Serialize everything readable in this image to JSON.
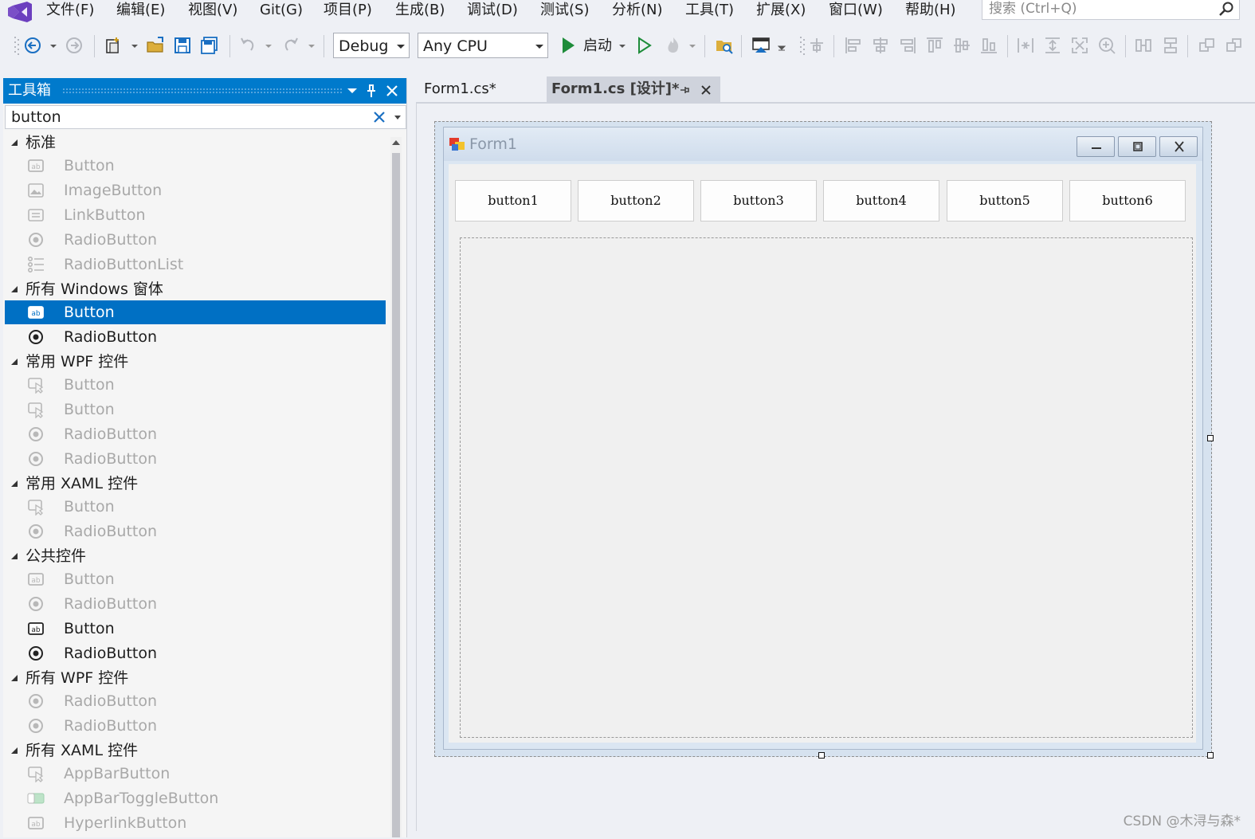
{
  "menu": {
    "items": [
      "文件(F)",
      "编辑(E)",
      "视图(V)",
      "Git(G)",
      "项目(P)",
      "生成(B)",
      "调试(D)",
      "测试(S)",
      "分析(N)",
      "工具(T)",
      "扩展(X)",
      "窗口(W)",
      "帮助(H)"
    ],
    "search_placeholder": "搜索 (Ctrl+Q)"
  },
  "toolbar": {
    "configuration": "Debug",
    "platform": "Any CPU",
    "start_label": "启动",
    "accent_color": "#1e8c3a"
  },
  "toolbox": {
    "title": "工具箱",
    "search_value": "button",
    "groups": [
      {
        "label": "标准",
        "items": [
          {
            "label": "Button",
            "icon": "button-icon",
            "enabled": false
          },
          {
            "label": "ImageButton",
            "icon": "image-button-icon",
            "enabled": false
          },
          {
            "label": "LinkButton",
            "icon": "link-button-icon",
            "enabled": false
          },
          {
            "label": "RadioButton",
            "icon": "radio-icon",
            "enabled": false
          },
          {
            "label": "RadioButtonList",
            "icon": "list-icon",
            "enabled": false
          }
        ]
      },
      {
        "label": "所有 Windows 窗体",
        "items": [
          {
            "label": "Button",
            "icon": "button-icon",
            "enabled": true,
            "selected": true
          },
          {
            "label": "RadioButton",
            "icon": "radio-icon",
            "enabled": true
          }
        ]
      },
      {
        "label": "常用 WPF 控件",
        "items": [
          {
            "label": "Button",
            "icon": "pointer-button-icon",
            "enabled": false
          },
          {
            "label": "Button",
            "icon": "pointer-button-icon",
            "enabled": false
          },
          {
            "label": "RadioButton",
            "icon": "radio-icon",
            "enabled": false
          },
          {
            "label": "RadioButton",
            "icon": "radio-icon",
            "enabled": false
          }
        ]
      },
      {
        "label": "常用 XAML 控件",
        "items": [
          {
            "label": "Button",
            "icon": "pointer-button-icon",
            "enabled": false
          },
          {
            "label": "RadioButton",
            "icon": "radio-icon",
            "enabled": false
          }
        ]
      },
      {
        "label": "公共控件",
        "items": [
          {
            "label": "Button",
            "icon": "button-icon",
            "enabled": false
          },
          {
            "label": "RadioButton",
            "icon": "radio-icon",
            "enabled": false
          },
          {
            "label": "Button",
            "icon": "button-icon",
            "enabled": true
          },
          {
            "label": "RadioButton",
            "icon": "radio-icon",
            "enabled": true
          }
        ]
      },
      {
        "label": "所有 WPF 控件",
        "items": [
          {
            "label": "RadioButton",
            "icon": "radio-icon",
            "enabled": false
          },
          {
            "label": "RadioButton",
            "icon": "radio-icon",
            "enabled": false
          }
        ]
      },
      {
        "label": "所有 XAML 控件",
        "items": [
          {
            "label": "AppBarButton",
            "icon": "pointer-button-icon",
            "enabled": false
          },
          {
            "label": "AppBarToggleButton",
            "icon": "toggle-icon",
            "enabled": false
          },
          {
            "label": "HyperlinkButton",
            "icon": "button-icon",
            "enabled": false
          }
        ]
      }
    ]
  },
  "tabs": [
    {
      "label": "Form1.cs*",
      "active": false
    },
    {
      "label": "Form1.cs [设计]*",
      "active": true
    }
  ],
  "designer": {
    "form_title": "Form1",
    "buttons": [
      "button1",
      "button2",
      "button3",
      "button4",
      "button5",
      "button6"
    ]
  },
  "watermark": "CSDN @木浔与森*"
}
